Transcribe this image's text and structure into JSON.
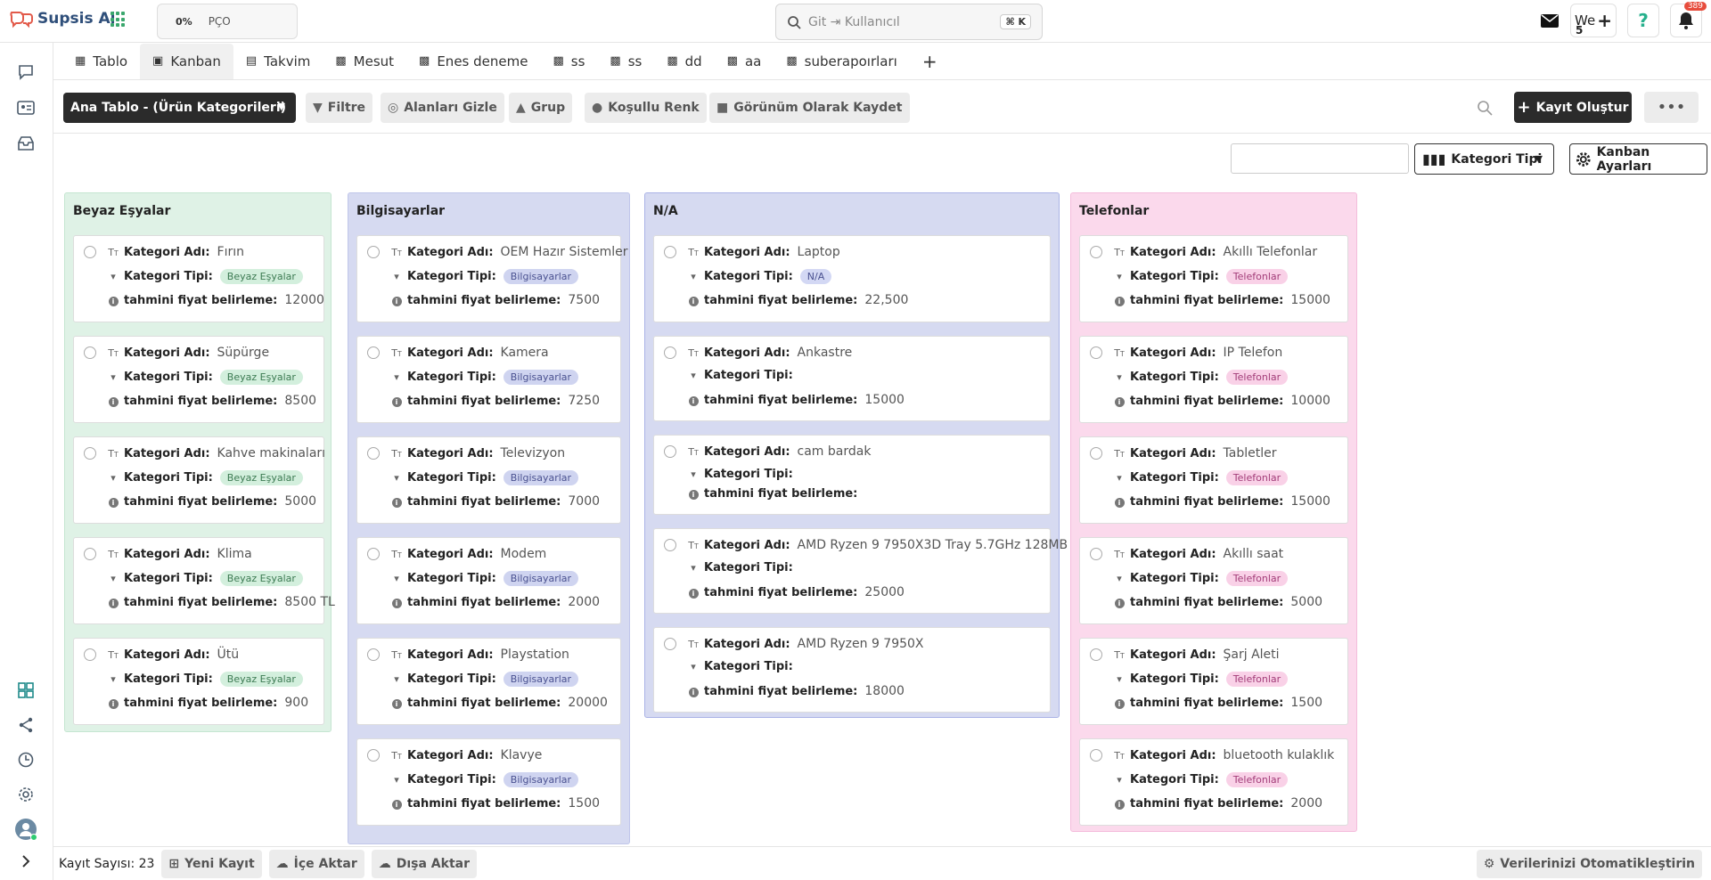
{
  "app": {
    "name": "Supsis Ai"
  },
  "workspace": {
    "percent": "0%",
    "name": "PÇO"
  },
  "search": {
    "placeholder": "Git ⇥ Kullanıcıl",
    "shortcut": "⌘ K"
  },
  "topright": {
    "user_label": "We",
    "user_num": "5",
    "notif_count": "389"
  },
  "tabs": [
    {
      "label": "Tablo",
      "icon": "table-icon"
    },
    {
      "label": "Kanban",
      "icon": "kanban-icon",
      "active": true
    },
    {
      "label": "Takvim",
      "icon": "calendar-icon"
    },
    {
      "label": "Mesut",
      "icon": "board-icon"
    },
    {
      "label": "Enes deneme",
      "icon": "board-icon"
    },
    {
      "label": "ss",
      "icon": "board-icon"
    },
    {
      "label": "ss",
      "icon": "board-icon"
    },
    {
      "label": "dd",
      "icon": "board-icon"
    },
    {
      "label": "aa",
      "icon": "board-icon"
    },
    {
      "label": "suberapoırları",
      "icon": "board-icon"
    }
  ],
  "toolbar": {
    "table_select": "Ana Tablo - (Ürün Kategorileri)",
    "filter": "Filtre",
    "hide_fields": "Alanları Gizle",
    "group": "Grup",
    "conditional_color": "Koşullu Renk",
    "save_view": "Görünüm Olarak Kaydet",
    "create": "Kayıt Oluştur"
  },
  "kanban_controls": {
    "group_by": "Kategori Tipi",
    "settings": "Kanban Ayarları"
  },
  "labels": {
    "name": "Kategori Adı:",
    "type": "Kategori Tipi:",
    "price": "tahmini fiyat belirleme:"
  },
  "columns": [
    {
      "title": "Beyaz Eşyalar",
      "bg": "#dff2e6",
      "border": "#c5e6d1",
      "pill_bg": "#d3efdd",
      "pill_color": "#3c7a52",
      "cards": [
        {
          "name": "Fırın",
          "type": "Beyaz Eşyalar",
          "price": "12000"
        },
        {
          "name": "Süpürge",
          "type": "Beyaz Eşyalar",
          "price": "8500"
        },
        {
          "name": "Kahve makinaları",
          "type": "Beyaz Eşyalar",
          "price": "5000"
        },
        {
          "name": "Klima",
          "type": "Beyaz Eşyalar",
          "price": "8500 TL"
        },
        {
          "name": "Ütü",
          "type": "Beyaz Eşyalar",
          "price": "900"
        }
      ]
    },
    {
      "title": "Bilgisayarlar",
      "bg": "#d6daf1",
      "border": "#c0c6ea",
      "pill_bg": "#cfd4f0",
      "pill_color": "#4a5190",
      "cards": [
        {
          "name": "OEM Hazır Sistemler",
          "type": "Bilgisayarlar",
          "price": "7500"
        },
        {
          "name": "Kamera",
          "type": "Bilgisayarlar",
          "price": "7250"
        },
        {
          "name": "Televizyon",
          "type": "Bilgisayarlar",
          "price": "7000"
        },
        {
          "name": "Modem",
          "type": "Bilgisayarlar",
          "price": "2000"
        },
        {
          "name": "Playstation",
          "type": "Bilgisayarlar",
          "price": "20000"
        },
        {
          "name": "Klavye",
          "type": "Bilgisayarlar",
          "price": "1500"
        }
      ]
    },
    {
      "title": "N/A",
      "bg": "#d6daf1",
      "border": "#aab3e6",
      "pill_bg": "#d3d8f4",
      "pill_color": "#4a5190",
      "cards": [
        {
          "name": "Laptop",
          "type": "N/A",
          "price": "22,500"
        },
        {
          "name": "Ankastre",
          "type": "",
          "price": "15000"
        },
        {
          "name": "cam bardak",
          "type": "",
          "price": ""
        },
        {
          "name": "AMD Ryzen 9 7950X3D Tray 5.7GHz 128MB",
          "type": "",
          "price": "25000"
        },
        {
          "name": "AMD Ryzen 9 7950X",
          "type": "",
          "price": "18000"
        }
      ]
    },
    {
      "title": "Telefonlar",
      "bg": "#fbd9ec",
      "border": "#f4bcdc",
      "pill_bg": "#f9d1e7",
      "pill_color": "#a23c78",
      "cards": [
        {
          "name": "Akıllı Telefonlar",
          "type": "Telefonlar",
          "price": "15000"
        },
        {
          "name": "IP Telefon",
          "type": "Telefonlar",
          "price": "10000"
        },
        {
          "name": "Tabletler",
          "type": "Telefonlar",
          "price": "15000"
        },
        {
          "name": "Akıllı saat",
          "type": "Telefonlar",
          "price": "5000"
        },
        {
          "name": "Şarj Aleti",
          "type": "Telefonlar",
          "price": "1500"
        },
        {
          "name": "bluetooth kulaklık",
          "type": "Telefonlar",
          "price": "2000"
        }
      ]
    }
  ],
  "footer": {
    "record_count": "Kayıt Sayısı: 23",
    "new_record": "Yeni Kayıt",
    "import": "İçe Aktar",
    "export": "Dışa Aktar",
    "automate": "Verilerinizi Otomatikleştirin"
  }
}
